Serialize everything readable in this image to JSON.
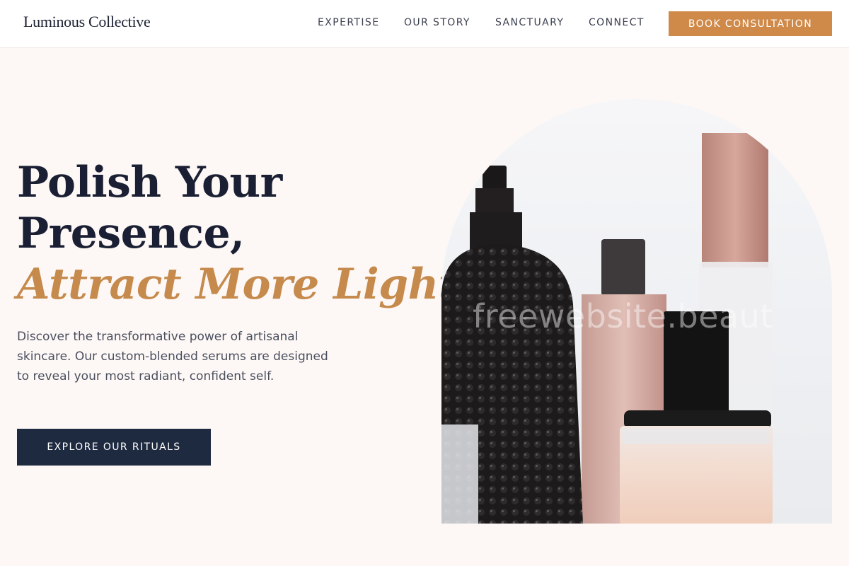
{
  "brand": {
    "name": "Luminous Collective"
  },
  "nav": {
    "items": [
      {
        "label": "EXPERTISE"
      },
      {
        "label": "OUR STORY"
      },
      {
        "label": "SANCTUARY"
      },
      {
        "label": "CONNECT"
      }
    ],
    "cta_label": "BOOK CONSULTATION"
  },
  "hero": {
    "title_line1": "Polish Your",
    "title_line2": "Presence,",
    "title_accent": "Attract More Light.",
    "description": "Discover the transformative power of artisanal skincare. Our custom-blended serums are designed to reveal your most radiant, confident self.",
    "cta_label": "EXPLORE OUR RITUALS",
    "image_watermark": "freewebsite.beaut"
  },
  "colors": {
    "accent": "#cf8948",
    "accent_text": "#c58a4c",
    "dark_button": "#1e2a40",
    "heading": "#1a1f33",
    "background": "#fdf8f6"
  }
}
